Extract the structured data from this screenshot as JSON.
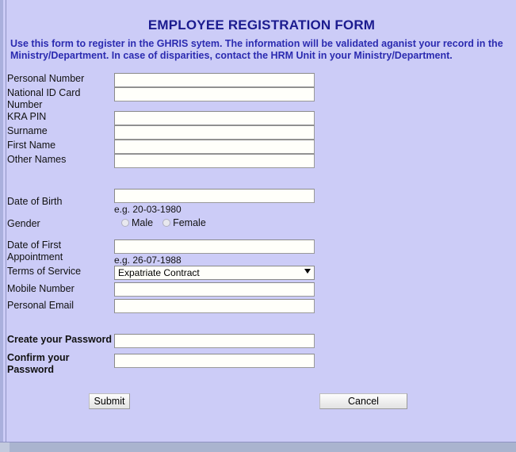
{
  "window": {
    "background_color": "#ccccf7",
    "scrollbar_color": "#aab4cf"
  },
  "header": {
    "title": "EMPLOYEE REGISTRATION FORM",
    "title_color": "#1b1b8f",
    "intro_color": "#2b2bb0",
    "intro_line_1": "Use this form to register in the GHRIS sytem. The information will be validated aganist your record in the",
    "intro_line_2": "Ministry/Department. In case of disparities, contact the HRM Unit in your Ministry/Department."
  },
  "form": {
    "fields": [
      {
        "id": "personal-number",
        "label": "Personal Number",
        "value": "",
        "placeholder": "",
        "bold": false
      },
      {
        "id": "national-id-card-number",
        "label": "National ID Card Number",
        "value": "",
        "placeholder": "",
        "bold": false
      },
      {
        "id": "kra-pin",
        "label": "KRA PIN",
        "value": "",
        "placeholder": "",
        "bold": false
      },
      {
        "id": "surname",
        "label": "Surname",
        "value": "",
        "placeholder": "",
        "bold": false
      },
      {
        "id": "first-name",
        "label": "First Name",
        "value": "",
        "placeholder": "",
        "bold": false
      },
      {
        "id": "other-names",
        "label": "Other Names",
        "value": "",
        "placeholder": "",
        "bold": false
      }
    ],
    "date_of_birth": {
      "label": "Date of Birth",
      "value": "",
      "hint": "e.g. 20-03-1980"
    },
    "gender": {
      "label": "Gender",
      "options": [
        {
          "label": "Male",
          "selected": false
        },
        {
          "label": "Female",
          "selected": false
        }
      ]
    },
    "date_of_first_appointment": {
      "label": "Date of First Appointment",
      "value": "",
      "hint": "e.g. 26-07-1988"
    },
    "terms_of_service": {
      "label": "Terms of Service",
      "selected": "Expatriate Contract"
    },
    "mobile_number": {
      "label": "Mobile Number",
      "value": ""
    },
    "personal_email": {
      "label": "Personal Email",
      "value": ""
    },
    "create_password": {
      "label": "Create your Password",
      "value": ""
    },
    "confirm_password": {
      "label": "Confirm your Password",
      "value": ""
    }
  },
  "buttons": {
    "submit": "Submit",
    "cancel": "Cancel"
  }
}
